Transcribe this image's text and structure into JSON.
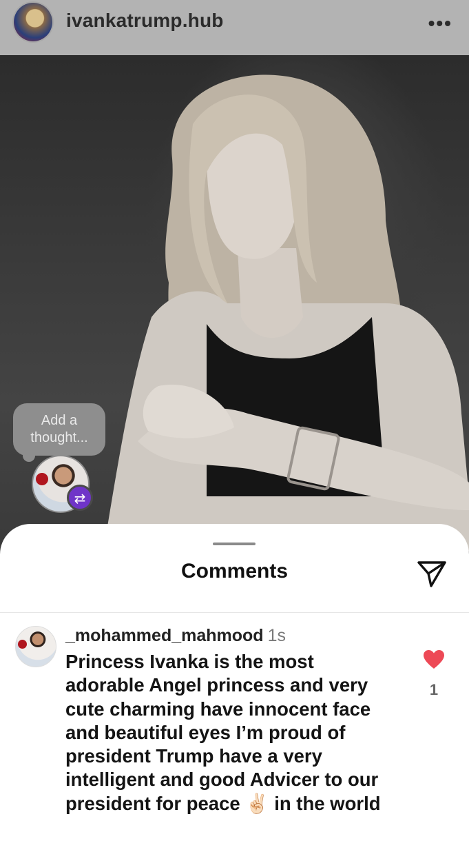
{
  "header": {
    "username": "ivankatrump.hub",
    "more_icon": "more-horizontal-icon",
    "more_label": "•••"
  },
  "story": {
    "thought_prompt_line1": "Add a",
    "thought_prompt_line2": "thought...",
    "repost_icon": "repost-icon",
    "repost_glyph": "⇄"
  },
  "comments_sheet": {
    "title": "Comments",
    "share_icon": "send-icon",
    "comments": [
      {
        "username": "_mohammed_mahmood",
        "time": "1s",
        "text_lines": [
          "Princess Ivanka is the most",
          "adorable Angel princess and very",
          "cute charming have innocent face",
          "and beautiful eyes I’m proud of",
          "president Trump have a very",
          "intelligent and good Advicer to our",
          "president for peace ✌🏻 in the world"
        ],
        "liked": true,
        "like_count": "1",
        "heart_color": "#ed4956"
      }
    ]
  },
  "colors": {
    "repost_badge": "#6f34c8",
    "sheet_background": "#ffffff"
  }
}
